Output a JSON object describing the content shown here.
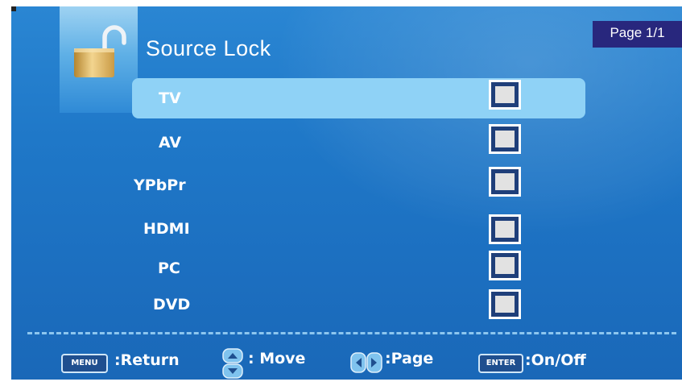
{
  "header": {
    "title": "Source Lock",
    "page_indicator": "Page 1/1"
  },
  "sources": [
    {
      "label": "TV",
      "selected": true,
      "locked": false
    },
    {
      "label": "AV",
      "selected": false,
      "locked": false
    },
    {
      "label": "YPbPr",
      "selected": false,
      "locked": false
    },
    {
      "label": "HDMI",
      "selected": false,
      "locked": false
    },
    {
      "label": "PC",
      "selected": false,
      "locked": false
    },
    {
      "label": "DVD",
      "selected": false,
      "locked": false
    }
  ],
  "footer": {
    "menu_key": "MENU",
    "return_label": ":Return",
    "move_label": ": Move",
    "page_label": ":Page",
    "enter_key": "ENTER",
    "onoff_label": ":On/Off"
  },
  "colors": {
    "background": "#1f78c8",
    "selected_row": "#8fd2f6",
    "page_badge": "#28277d",
    "checkbox_fill": "#e2e2e2"
  },
  "icons": {
    "lock": "open-padlock-icon",
    "move": "up-down-arrows-icon",
    "page": "left-right-arrows-icon"
  }
}
